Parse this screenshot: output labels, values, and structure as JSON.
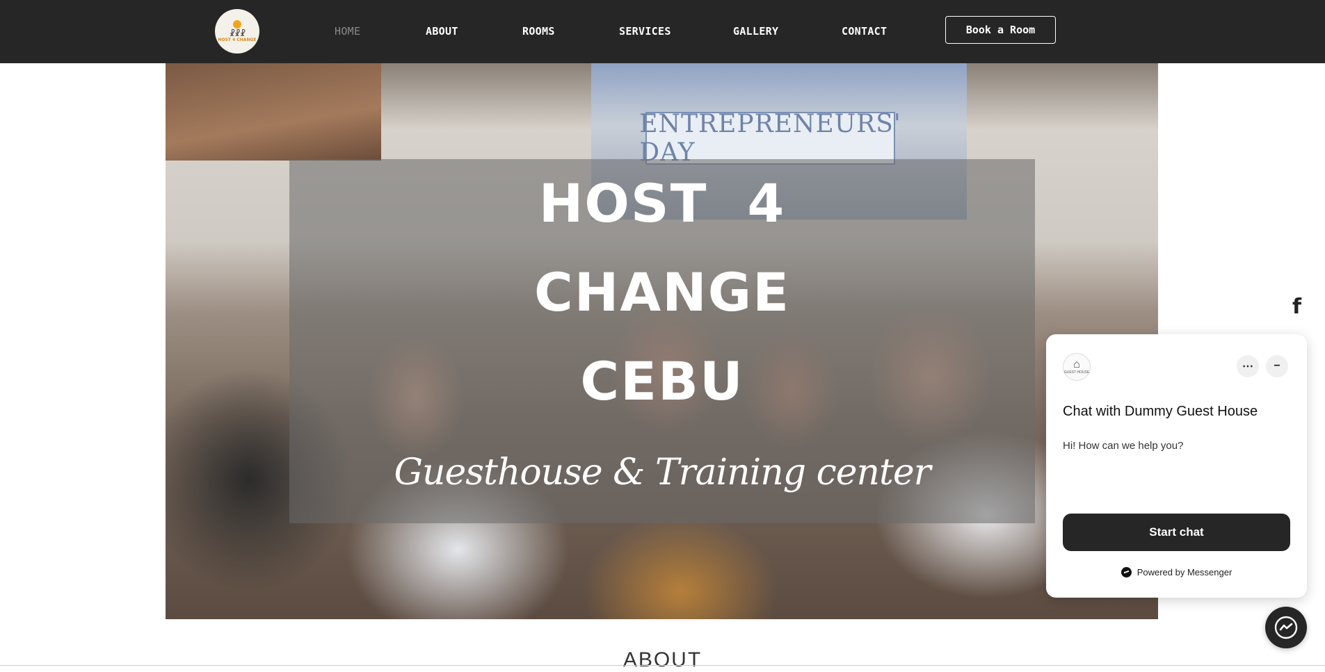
{
  "nav": {
    "logo_text": "HOST 4 CHANGE",
    "items": [
      {
        "label": "HOME",
        "active": true
      },
      {
        "label": "ABOUT",
        "active": false
      },
      {
        "label": "ROOMS",
        "active": false
      },
      {
        "label": "SERVICES",
        "active": false
      },
      {
        "label": "GALLERY",
        "active": false
      },
      {
        "label": "CONTACT",
        "active": false
      }
    ],
    "cta_label": "Book a Room"
  },
  "hero": {
    "title_lines": [
      "HOST  4",
      "CHANGE",
      "CEBU"
    ],
    "subtitle": "Guesthouse & Training center",
    "poster_text": "ENTREPRENEURS' DAY"
  },
  "next_section_heading": "ABOUT",
  "chat": {
    "avatar_text": "GUEST HOUSE",
    "title": "Chat with Dummy Guest House",
    "message": "Hi! How can we help you?",
    "start_label": "Start chat",
    "powered_by": "Powered by Messenger"
  },
  "colors": {
    "nav_bg": "#262626",
    "nav_active": "#8a8a8a",
    "accent_dark": "#262626",
    "logo_orange": "#f2a51c"
  },
  "icons": {
    "social": "facebook-icon",
    "chat_more": "more-options-icon",
    "chat_minimize": "minimize-icon",
    "fab": "messenger-icon"
  }
}
